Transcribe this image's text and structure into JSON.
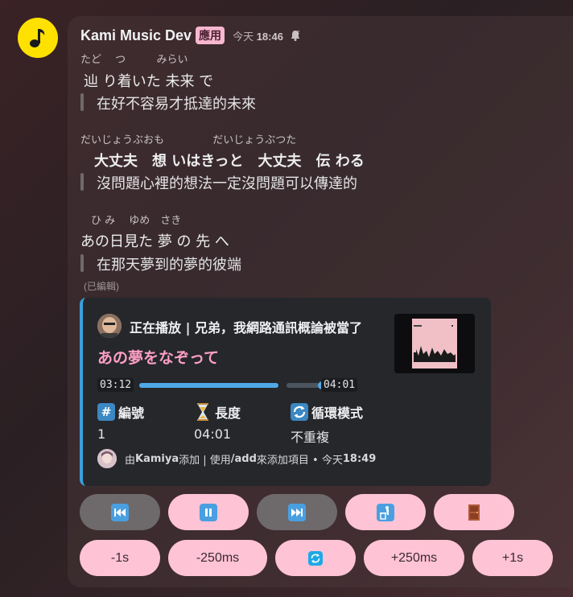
{
  "message": {
    "author": "Kami Music Dev",
    "app_badge": "應用",
    "timestamp_day": "今天",
    "timestamp_time": "18:46",
    "edited_label": "(已編輯)"
  },
  "lyrics": [
    {
      "ruby": "たど　 つ　　   みらい",
      "japanese": "辿 り着いた 未来 で",
      "chinese": "在好不容易才抵達的未來",
      "bold": false
    },
    {
      "ruby": "だいじょうぶおも　　　　  だいじょうぶつた",
      "japanese": "大丈夫　想 いはきっと　大丈夫　伝 わる",
      "chinese": "沒問題心裡的想法一定沒問題可以傳達的",
      "bold": true
    },
    {
      "ruby": "　ひ み　 ゆめ　さき",
      "japanese": "あの日見た 夢 の 先 へ",
      "chinese": "在那天夢到的夢的彼端",
      "bold": false
    }
  ],
  "embed": {
    "now_playing_title": "正在播放 | 兄弟，我網路通訊概論被當了",
    "song_title": "あの夢をなぞって",
    "elapsed": "03:12",
    "duration": "04:01",
    "progress_fraction": 0.797,
    "fields": [
      {
        "icon": "hash-icon",
        "name": "編號",
        "value": "1"
      },
      {
        "icon": "hourglass-icon",
        "name": "長度",
        "value": "04:01"
      },
      {
        "icon": "repeat-icon",
        "name": "循環模式",
        "value": "不重複"
      }
    ],
    "footer": {
      "prefix": "由 ",
      "user": "Kamiya",
      "middle": " 添加 | 使用 ",
      "command": "/add",
      "suffix": " 來添加項目 • 今天 ",
      "time": "18:49"
    }
  },
  "buttons_row1": [
    {
      "name": "previous-button",
      "icon": "previous-track-icon",
      "style": "gray"
    },
    {
      "name": "pause-button",
      "icon": "pause-icon",
      "style": "pink"
    },
    {
      "name": "next-button",
      "icon": "next-track-icon",
      "style": "gray"
    },
    {
      "name": "clear-queue-button",
      "icon": "trash-person-icon",
      "style": "pink"
    },
    {
      "name": "leave-button",
      "icon": "door-icon",
      "style": "pink"
    }
  ],
  "buttons_row2": [
    {
      "name": "seek-back-1s-button",
      "label": "-1s"
    },
    {
      "name": "seek-back-250ms-button",
      "label": "-250ms"
    },
    {
      "name": "sync-button",
      "label": ""
    },
    {
      "name": "seek-forward-250ms-button",
      "label": "+250ms"
    },
    {
      "name": "seek-forward-1s-button",
      "label": "+1s"
    }
  ],
  "colors": {
    "accent_blue": "#3c9fdc",
    "song_pink": "#ff9fc6",
    "button_pink": "#ffc3d6",
    "button_gray": "#6e6a6b",
    "avatar_yellow": "#ffe100"
  }
}
